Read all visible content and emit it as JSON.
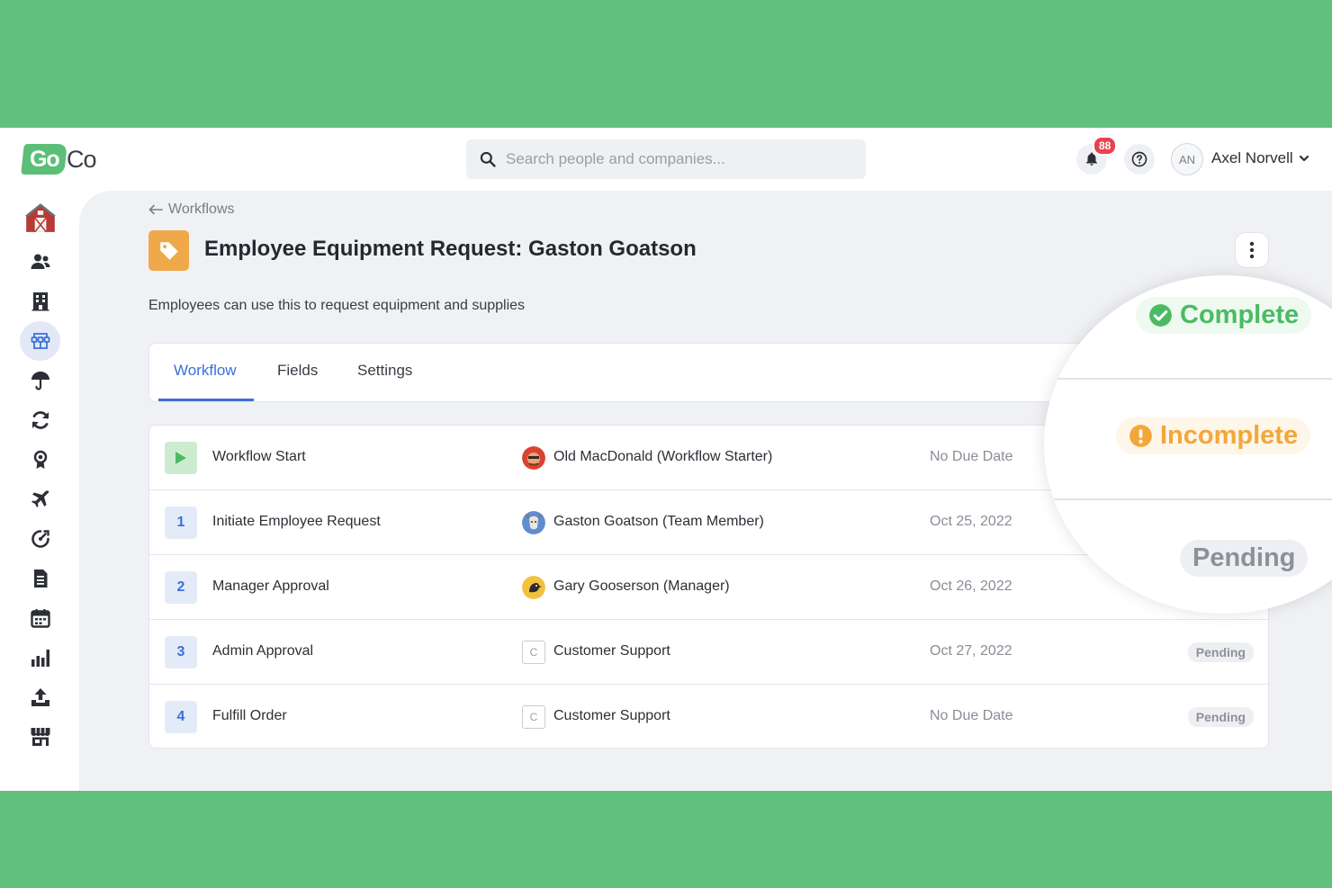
{
  "app": {
    "logo_text_a": "Go",
    "logo_text_b": "Co",
    "search_placeholder": "Search people and companies...",
    "notification_count": "88",
    "user_initials": "AN",
    "user_name": "Axel Norvell"
  },
  "sidebar": {
    "items": [
      {
        "name": "home-barn-icon"
      },
      {
        "name": "people-icon"
      },
      {
        "name": "company-building-icon"
      },
      {
        "name": "workflow-icon",
        "active": true
      },
      {
        "name": "benefits-umbrella-icon"
      },
      {
        "name": "sync-icon"
      },
      {
        "name": "award-icon"
      },
      {
        "name": "time-off-plane-icon"
      },
      {
        "name": "performance-icon"
      },
      {
        "name": "document-icon"
      },
      {
        "name": "calendar-icon"
      },
      {
        "name": "reports-chart-icon"
      },
      {
        "name": "upload-icon"
      },
      {
        "name": "marketplace-icon"
      }
    ]
  },
  "page": {
    "breadcrumb": "Workflows",
    "title": "Employee Equipment Request: Gaston Goatson",
    "description": "Employees can use this to request equipment and supplies",
    "tabs": [
      {
        "label": "Workflow",
        "active": true
      },
      {
        "label": "Fields"
      },
      {
        "label": "Settings"
      }
    ]
  },
  "steps": [
    {
      "number": "",
      "name": "Workflow Start",
      "assignee": "Old MacDonald (Workflow Starter)",
      "assignee_icon": "farmer-avatar",
      "due": "No Due Date",
      "status": ""
    },
    {
      "number": "1",
      "name": "Initiate Employee Request",
      "assignee": "Gaston Goatson (Team Member)",
      "assignee_icon": "goat-avatar",
      "due": "Oct 25, 2022",
      "status": ""
    },
    {
      "number": "2",
      "name": "Manager Approval",
      "assignee": "Gary Gooserson (Manager)",
      "assignee_icon": "goose-avatar",
      "due": "Oct 26, 2022",
      "status": ""
    },
    {
      "number": "3",
      "name": "Admin Approval",
      "assignee": "Customer Support",
      "assignee_icon": "C",
      "due": "Oct 27, 2022",
      "status": "Pending"
    },
    {
      "number": "4",
      "name": "Fulfill Order",
      "assignee": "Customer Support",
      "assignee_icon": "C",
      "due": "No Due Date",
      "status": "Pending"
    }
  ],
  "zoom": {
    "complete": "Complete",
    "incomplete": "Incomplete",
    "pending": "Pending"
  },
  "colors": {
    "background_green": "#62c07d",
    "accent_blue": "#3b6fd9",
    "complete_green": "#4bbb63",
    "incomplete_orange": "#f3a73a",
    "tag_orange": "#f0a94a",
    "badge_red": "#e8424f"
  }
}
